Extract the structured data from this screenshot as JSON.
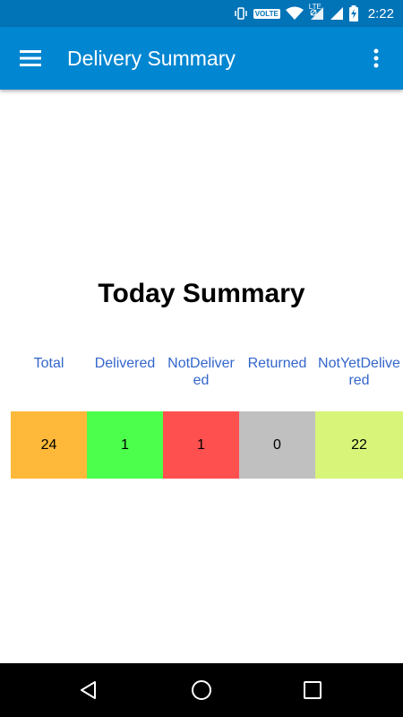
{
  "status_bar": {
    "network_label": "VOLTE",
    "lte_label": "LTE",
    "time": "2:22",
    "icons": [
      "vibrate-icon",
      "volte-icon",
      "wifi-icon",
      "signal-icon",
      "signal-icon",
      "battery-charging-icon"
    ]
  },
  "app_bar": {
    "title": "Delivery Summary",
    "menu_icon": "hamburger-menu-icon",
    "overflow_icon": "more-vert-icon",
    "color": "#0186d1"
  },
  "summary": {
    "heading": "Today Summary",
    "columns": [
      {
        "header": "Total",
        "value": "24",
        "color": "#ffb93a"
      },
      {
        "header": "Delivered",
        "value": "1",
        "color": "#4cff4c"
      },
      {
        "header": "NotDelivered",
        "value": "1",
        "color": "#ff5050"
      },
      {
        "header": "Returned",
        "value": "0",
        "color": "#c0c0c0"
      },
      {
        "header": "NotYetDelivered",
        "value": "22",
        "color": "#d8f57a"
      }
    ]
  },
  "nav_bar": {
    "back_icon": "back-triangle-icon",
    "home_icon": "home-circle-icon",
    "recents_icon": "recents-square-icon"
  }
}
